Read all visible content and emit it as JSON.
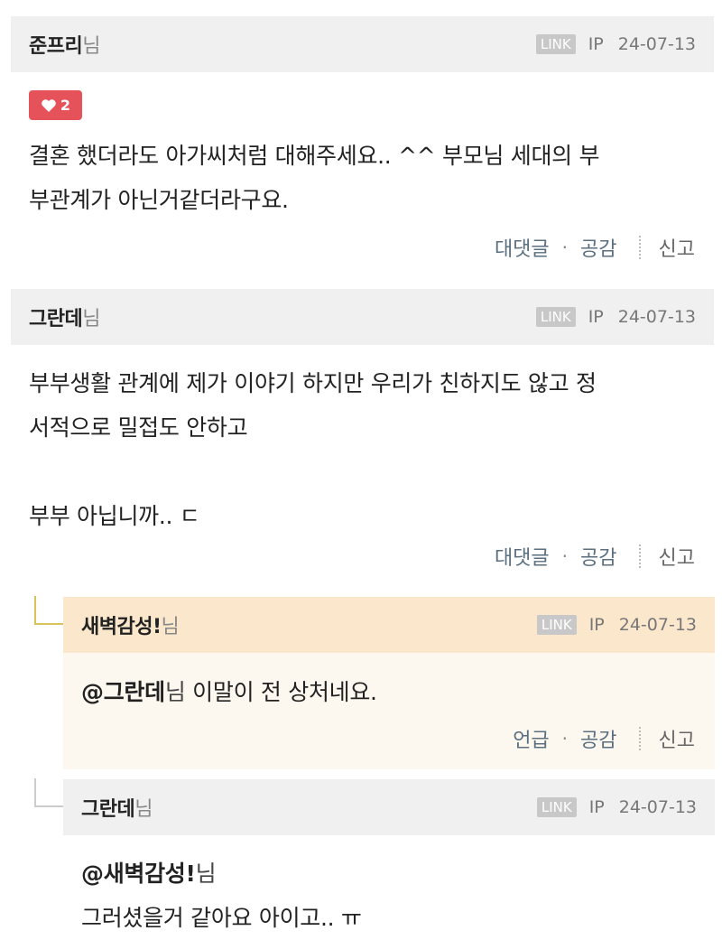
{
  "comments": [
    {
      "author": "준프리",
      "suffix": "님",
      "link": "LINK",
      "ip": "IP",
      "date": "24-07-13",
      "likes": "2",
      "lines": [
        "결혼 했더라도 아가씨처럼 대해주세요.. ^^ 부모님 세대의 부",
        "부관계가 아닌거같더라구요."
      ],
      "actions": {
        "reply": "대댓글",
        "empathy": "공감",
        "report": "신고"
      }
    },
    {
      "author": "그란데",
      "suffix": "님",
      "link": "LINK",
      "ip": "IP",
      "date": "24-07-13",
      "lines": [
        "부부생활 관계에 제가 이야기 하지만 우리가 친하지도 않고 정",
        "서적으로 밀접도 안하고",
        "",
        "부부 아닙니까.. ㄷ"
      ],
      "actions": {
        "reply": "대댓글",
        "empathy": "공감",
        "report": "신고"
      }
    }
  ],
  "replies": [
    {
      "author": "새벽감성!",
      "suffix": "님",
      "link": "LINK",
      "ip": "IP",
      "date": "24-07-13",
      "mention": "@그란데",
      "mention_suffix": "님",
      "text": " 이말이 전 상처네요.",
      "actions": {
        "mention": "언급",
        "empathy": "공감",
        "report": "신고"
      }
    },
    {
      "author": "그란데",
      "suffix": "님",
      "link": "LINK",
      "ip": "IP",
      "date": "24-07-13",
      "mention": "@새벽감성!",
      "mention_suffix": "님",
      "text": "그러셨을거 같아요 아이고.. ㅠ"
    }
  ],
  "colors": {
    "header_bg": "#f0f0f0",
    "highlight_header_bg": "#fbe7cc",
    "highlight_body_bg": "#fdf8ef",
    "like_badge": "#e5525a",
    "tree_line_highlight": "#d8c45a",
    "tree_line": "#cccccc"
  }
}
